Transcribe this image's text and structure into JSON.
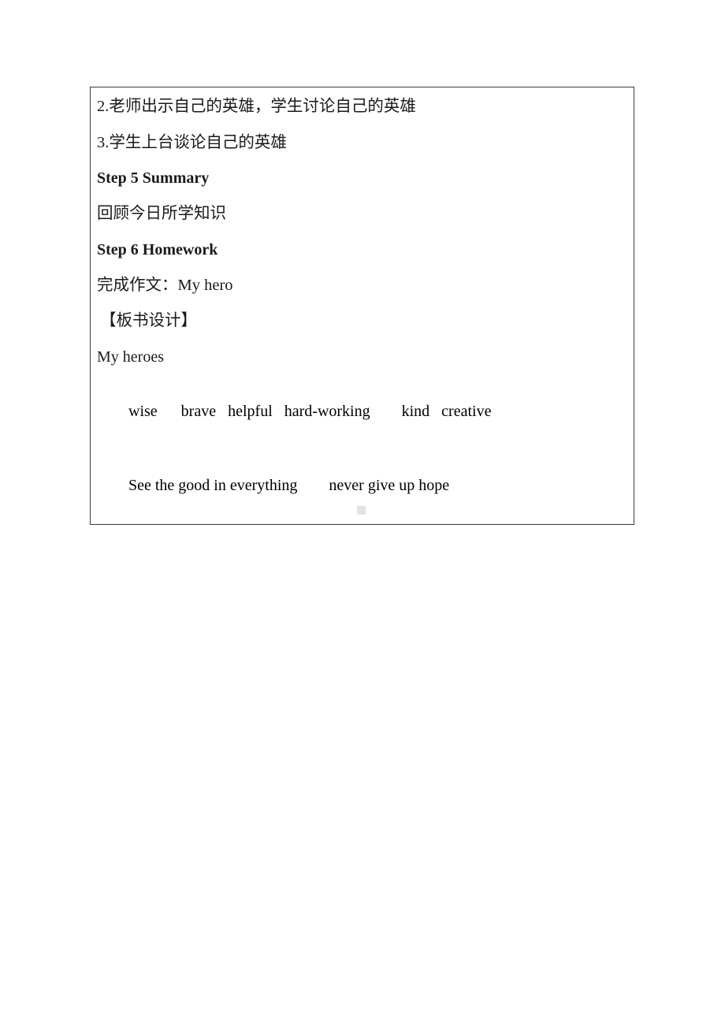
{
  "document": {
    "page_background": "#ffffff",
    "border_color": "#3a3a3a",
    "text_color": "#1a1a1a",
    "table": {
      "lines": [
        {
          "id": "activity-2",
          "text": "2.老师出示自己的英雄，学生讨论自己的英雄",
          "style": "cjk"
        },
        {
          "id": "activity-3",
          "text": "3.学生上台谈论自己的英雄",
          "style": "cjk"
        },
        {
          "id": "step5-heading",
          "text": "Step 5 Summary",
          "style": "heading"
        },
        {
          "id": "step5-body",
          "text": "回顾今日所学知识",
          "style": "cjk"
        },
        {
          "id": "step6-heading",
          "text": "Step 6 Homework",
          "style": "heading"
        },
        {
          "id": "step6-body",
          "text": "完成作文：My hero",
          "style": "cjk"
        },
        {
          "id": "blackboard-design-title",
          "text": "【板书设计】",
          "style": "section-title"
        },
        {
          "id": "board-title",
          "text": "My heroes",
          "style": "en"
        }
      ],
      "adjective_row": {
        "words": [
          "wise",
          "brave",
          "helpful",
          "hard-working",
          "kind",
          "creative"
        ],
        "gaps": [
          "      ",
          "   ",
          "   ",
          "        ",
          "   "
        ]
      },
      "phrase_row": {
        "phrases": [
          "See the good in everything",
          "never give up hope"
        ],
        "gap": "        "
      }
    },
    "page_mark": {
      "name": "page-watermark-square",
      "color": "#e2e2e2"
    }
  }
}
